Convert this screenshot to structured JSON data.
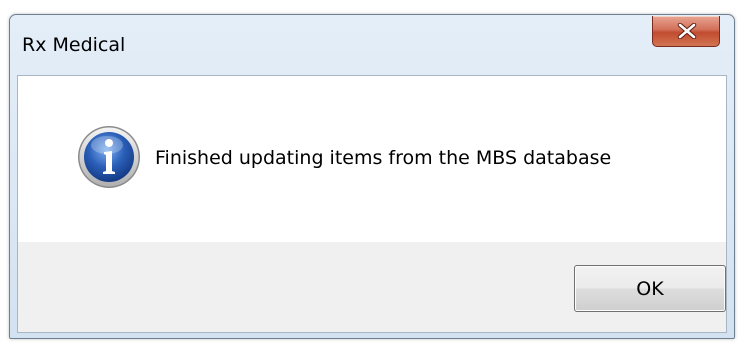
{
  "window": {
    "title": "Rx Medical",
    "close_icon": "close-icon"
  },
  "dialog": {
    "icon": "info-icon",
    "message": "Finished updating items from the MBS database",
    "ok_label": "OK"
  },
  "colors": {
    "close_button": "#c24c30",
    "info_icon": "#2a5fb8"
  }
}
